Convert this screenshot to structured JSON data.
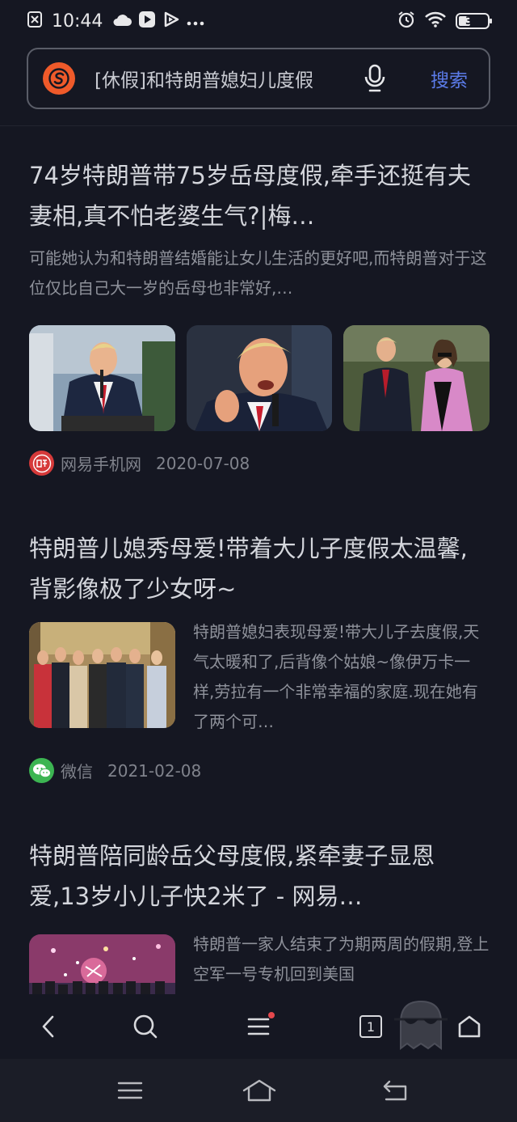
{
  "status_bar": {
    "time": "10:44",
    "battery": "37",
    "battery_level": 0.37
  },
  "search": {
    "query": "[休假]和特朗普媳妇儿度假",
    "button": "搜索"
  },
  "results": [
    {
      "title": "74岁特朗普带75岁岳母度假,牵手还挺有夫妻相,真不怕老婆生气?|梅…",
      "snippet": "可能她认为和特朗普结婚能让女儿生活的更好吧,而特朗普对于这位仅比自己大一岁的岳母也非常好,…",
      "source": "网易手机网",
      "date": "2020-07-08",
      "source_icon": "netease-icon"
    },
    {
      "title": "特朗普儿媳秀母爱!带着大儿子度假太温馨,背影像极了少女呀~",
      "snippet": "特朗普媳妇表现母爱!带大儿子去度假,天气太暖和了,后背像个姑娘~像伊万卡一样,劳拉有一个非常幸福的家庭.现在她有了两个可…",
      "source": "微信",
      "date": "2021-02-08",
      "source_icon": "wechat-icon"
    },
    {
      "title": "特朗普陪同龄岳父母度假,紧牵妻子显恩爱,13岁小儿子快2米了 - 网易…",
      "snippet": "特朗普一家人结束了为期两周的假期,登上空军一号专机回到美国"
    }
  ],
  "toolbar": {
    "tab_count": "1"
  },
  "colors": {
    "background": "#151722",
    "accent": "#5b7be8",
    "logo": "#ef5a2a",
    "notification": "#e5484d"
  }
}
